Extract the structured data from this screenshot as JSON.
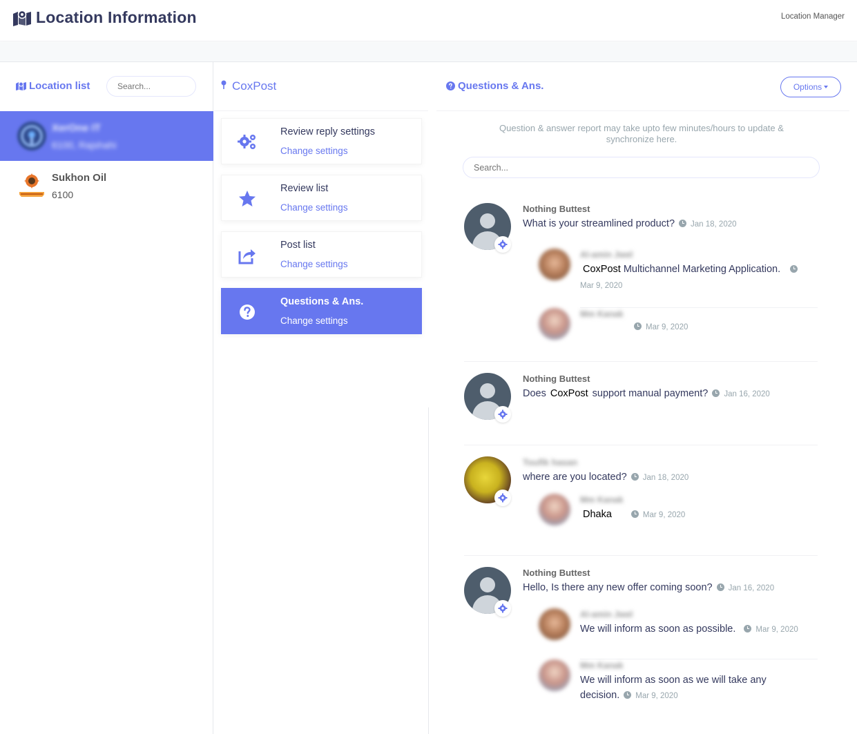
{
  "header": {
    "title": "Location Information",
    "manager_link": "Location Manager"
  },
  "locations": {
    "heading": "Location list",
    "search_placeholder": "Search...",
    "items": [
      {
        "name": "XerOne IT",
        "sub": "6100, Rajshahi",
        "active": true
      },
      {
        "name": "Sukhon Oil",
        "sub": "6100",
        "active": false
      }
    ]
  },
  "settings": {
    "heading": "CoxPost",
    "cards": [
      {
        "title": "Review reply settings",
        "link": "Change settings",
        "icon": "gears-icon"
      },
      {
        "title": "Review list",
        "link": "Change settings",
        "icon": "star-icon"
      },
      {
        "title": "Post list",
        "link": "Change settings",
        "icon": "share-icon"
      },
      {
        "title": "Questions & Ans.",
        "link": "Change settings",
        "icon": "question-icon",
        "active": true
      }
    ]
  },
  "qa": {
    "heading": "Questions & Ans.",
    "options_label": "Options",
    "notice": "Question & answer report may take upto few minutes/hours to update & synchronize here.",
    "search_placeholder": "Search...",
    "questions": [
      {
        "author": "Nothing Buttest",
        "text": "What is your streamlined product?",
        "date": "Jan 18, 2020",
        "answers": [
          {
            "name": "Al-amin Jwel",
            "brand": "CoxPost",
            "text": "Multichannel Marketing Application.",
            "date": "Mar 9, 2020"
          },
          {
            "name": "Mm Kanak",
            "text": "",
            "date": "Mar 9, 2020"
          }
        ]
      },
      {
        "author": "Nothing Buttest",
        "text_before": "Does",
        "brand": "CoxPost",
        "text_after": "support manual payment?",
        "date": "Jan 16, 2020",
        "answers": []
      },
      {
        "author": "Toufik hasan",
        "text": "where are you located?",
        "date": "Jan 18, 2020",
        "answers": [
          {
            "name": "Mm Kanak",
            "brand": "Dhaka",
            "text": "",
            "date": "Mar 9, 2020"
          }
        ]
      },
      {
        "author": "Nothing Buttest",
        "text": "Hello, Is there any new offer coming soon?",
        "date": "Jan 16, 2020",
        "answers": [
          {
            "name": "Al-amin Jwel",
            "text": "We will inform as soon as possible.",
            "date": "Mar 9, 2020"
          },
          {
            "name": "Mm Kanak",
            "text_line1": "We will inform as soon as we will take any",
            "text_line2": "decision.",
            "date": "Mar 9, 2020"
          }
        ]
      }
    ]
  },
  "colors": {
    "accent": "#6777ef",
    "text": "#34395e",
    "muted": "#98a6ad"
  }
}
